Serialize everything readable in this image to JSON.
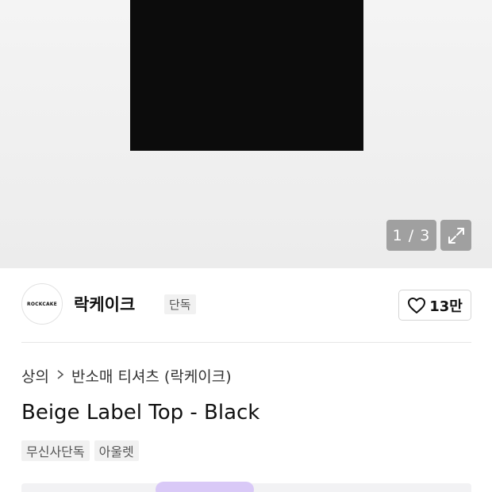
{
  "gallery": {
    "counter": "1 / 3",
    "expand_icon": "expand-arrows-icon"
  },
  "brand": {
    "logo_text": "ROCKCAKE",
    "name": "락케이크",
    "exclusive_badge": "단독"
  },
  "like": {
    "icon": "heart-outline-icon",
    "count": "13만"
  },
  "breadcrumb": {
    "category": "상의",
    "subcategory": "반소매 티셔츠 (락케이크)"
  },
  "product": {
    "title": "Beige Label Top - Black"
  },
  "tags": [
    "무신사단독",
    "아울렛"
  ],
  "colors": {
    "shirt": "#0c0c0c",
    "hero_background": "#efefef",
    "tag_background": "#f1f1f1"
  }
}
